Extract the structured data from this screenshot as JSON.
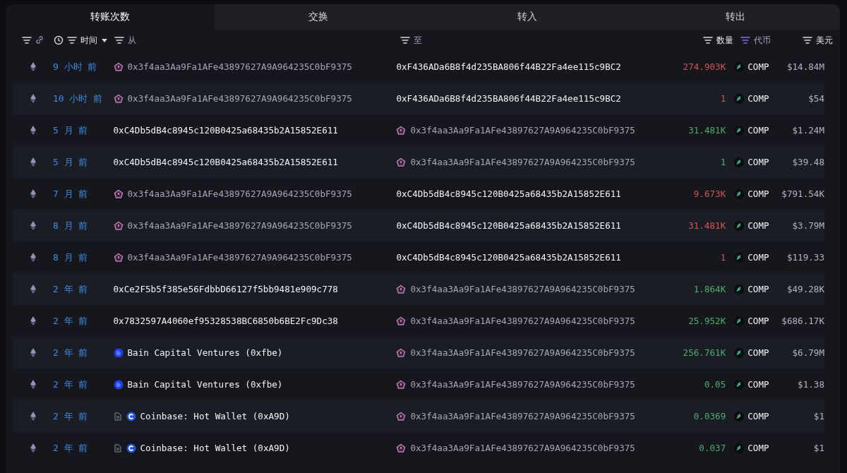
{
  "tabs": [
    {
      "label": "转账次数",
      "selected": true
    },
    {
      "label": "交换",
      "selected": false
    },
    {
      "label": "转入",
      "selected": false
    },
    {
      "label": "转出",
      "selected": false
    }
  ],
  "columns": {
    "time": "时间",
    "from": "从",
    "to": "至",
    "amount": "数量",
    "token": "代币",
    "usd": "美元"
  },
  "rows": [
    {
      "time": "9 小时 前",
      "from": {
        "kind": "tracked",
        "text": "0x3f4aa3Aa9Fa1AFe43897627A9A964235C0bF9375"
      },
      "to": {
        "kind": "plain",
        "text": "0xF436ADa6B8f4d235BA806f44B22Fa4ee115c9BC2"
      },
      "amount": {
        "text": "274.903K",
        "kind": "out"
      },
      "token": "COMP",
      "usd": "$14.84M"
    },
    {
      "time": "10 小时 前",
      "from": {
        "kind": "tracked",
        "text": "0x3f4aa3Aa9Fa1AFe43897627A9A964235C0bF9375"
      },
      "to": {
        "kind": "plain",
        "text": "0xF436ADa6B8f4d235BA806f44B22Fa4ee115c9BC2"
      },
      "amount": {
        "text": "1",
        "kind": "out"
      },
      "token": "COMP",
      "usd": "$54"
    },
    {
      "time": "5 月 前",
      "from": {
        "kind": "plain",
        "text": "0xC4Db5dB4c8945c120B0425a68435b2A15852E611"
      },
      "to": {
        "kind": "tracked",
        "text": "0x3f4aa3Aa9Fa1AFe43897627A9A964235C0bF9375"
      },
      "amount": {
        "text": "31.481K",
        "kind": "in"
      },
      "token": "COMP",
      "usd": "$1.24M"
    },
    {
      "time": "5 月 前",
      "from": {
        "kind": "plain",
        "text": "0xC4Db5dB4c8945c120B0425a68435b2A15852E611"
      },
      "to": {
        "kind": "tracked",
        "text": "0x3f4aa3Aa9Fa1AFe43897627A9A964235C0bF9375"
      },
      "amount": {
        "text": "1",
        "kind": "in"
      },
      "token": "COMP",
      "usd": "$39.48"
    },
    {
      "time": "7 月 前",
      "from": {
        "kind": "tracked",
        "text": "0x3f4aa3Aa9Fa1AFe43897627A9A964235C0bF9375"
      },
      "to": {
        "kind": "plain",
        "text": "0xC4Db5dB4c8945c120B0425a68435b2A15852E611"
      },
      "amount": {
        "text": "9.673K",
        "kind": "out"
      },
      "token": "COMP",
      "usd": "$791.54K"
    },
    {
      "time": "8 月 前",
      "from": {
        "kind": "tracked",
        "text": "0x3f4aa3Aa9Fa1AFe43897627A9A964235C0bF9375"
      },
      "to": {
        "kind": "plain",
        "text": "0xC4Db5dB4c8945c120B0425a68435b2A15852E611"
      },
      "amount": {
        "text": "31.481K",
        "kind": "out"
      },
      "token": "COMP",
      "usd": "$3.79M"
    },
    {
      "time": "8 月 前",
      "from": {
        "kind": "tracked",
        "text": "0x3f4aa3Aa9Fa1AFe43897627A9A964235C0bF9375"
      },
      "to": {
        "kind": "plain",
        "text": "0xC4Db5dB4c8945c120B0425a68435b2A15852E611"
      },
      "amount": {
        "text": "1",
        "kind": "out"
      },
      "token": "COMP",
      "usd": "$119.33"
    },
    {
      "time": "2 年 前",
      "from": {
        "kind": "plain",
        "text": "0xCe2F5b5f385e56FdbbD66127f5bb9481e909c778"
      },
      "to": {
        "kind": "tracked",
        "text": "0x3f4aa3Aa9Fa1AFe43897627A9A964235C0bF9375"
      },
      "amount": {
        "text": "1.864K",
        "kind": "in"
      },
      "token": "COMP",
      "usd": "$49.28K"
    },
    {
      "time": "2 年 前",
      "from": {
        "kind": "plain",
        "text": "0x7832597A4060ef95328538BC6850b6BE2Fc9Dc38"
      },
      "to": {
        "kind": "tracked",
        "text": "0x3f4aa3Aa9Fa1AFe43897627A9A964235C0bF9375"
      },
      "amount": {
        "text": "25.952K",
        "kind": "in"
      },
      "token": "COMP",
      "usd": "$686.17K"
    },
    {
      "time": "2 年 前",
      "from": {
        "kind": "fund",
        "text": "Bain Capital Ventures (0xfbe)"
      },
      "to": {
        "kind": "tracked",
        "text": "0x3f4aa3Aa9Fa1AFe43897627A9A964235C0bF9375"
      },
      "amount": {
        "text": "256.761K",
        "kind": "in"
      },
      "token": "COMP",
      "usd": "$6.79M"
    },
    {
      "time": "2 年 前",
      "from": {
        "kind": "fund",
        "text": "Bain Capital Ventures (0xfbe)"
      },
      "to": {
        "kind": "tracked",
        "text": "0x3f4aa3Aa9Fa1AFe43897627A9A964235C0bF9375"
      },
      "amount": {
        "text": "0.05",
        "kind": "in"
      },
      "token": "COMP",
      "usd": "$1.38"
    },
    {
      "time": "2 年 前",
      "from": {
        "kind": "exchange",
        "text": "Coinbase: Hot Wallet (0xA9D)"
      },
      "to": {
        "kind": "tracked",
        "text": "0x3f4aa3Aa9Fa1AFe43897627A9A964235C0bF9375"
      },
      "amount": {
        "text": "0.0369",
        "kind": "in"
      },
      "token": "COMP",
      "usd": "$1"
    },
    {
      "time": "2 年 前",
      "from": {
        "kind": "exchange",
        "text": "Coinbase: Hot Wallet (0xA9D)"
      },
      "to": {
        "kind": "tracked",
        "text": "0x3f4aa3Aa9Fa1AFe43897627A9A964235C0bF9375"
      },
      "amount": {
        "text": "0.037",
        "kind": "in"
      },
      "token": "COMP",
      "usd": "$1"
    }
  ]
}
